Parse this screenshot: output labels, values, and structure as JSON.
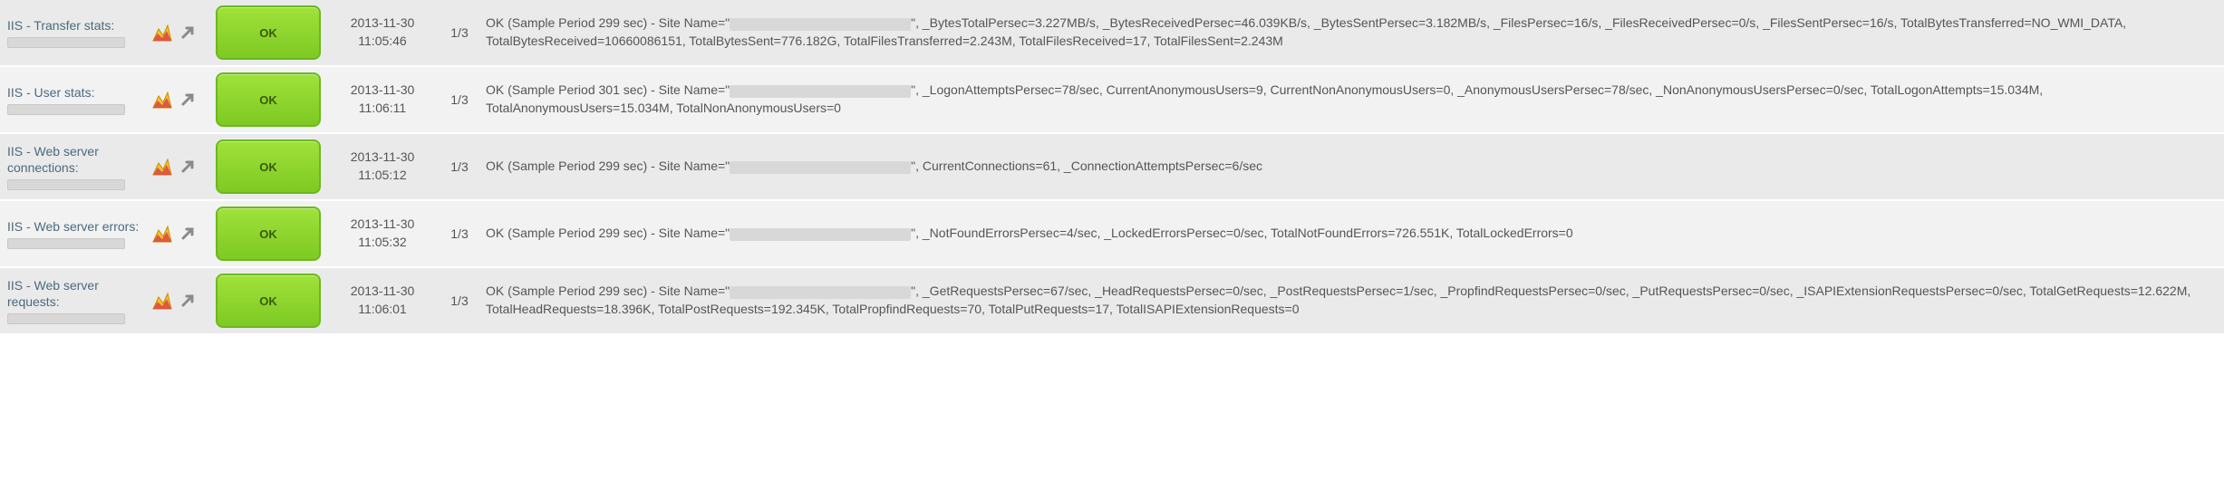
{
  "status_label": "OK",
  "colors": {
    "status_ok_bg": "#8ed62f",
    "status_ok_border": "#6bb81f"
  },
  "rows": [
    {
      "name": "IIS - Transfer stats:",
      "status": "OK",
      "timestamp": "2013-11-30 11:05:46",
      "count": "1/3",
      "sample_period": 299,
      "detail_pre": "OK (Sample Period 299 sec) - Site Name=\"",
      "detail_post": "\", _BytesTotalPersec=3.227MB/s, _BytesReceivedPersec=46.039KB/s, _BytesSentPersec=3.182MB/s, _FilesPersec=16/s, _FilesReceivedPersec=0/s, _FilesSentPersec=16/s, TotalBytesTransferred=NO_WMI_DATA, TotalBytesReceived=10660086151, TotalBytesSent=776.182G, TotalFilesTransferred=2.243M, TotalFilesReceived=17, TotalFilesSent=2.243M"
    },
    {
      "name": "IIS - User stats:",
      "status": "OK",
      "timestamp": "2013-11-30 11:06:11",
      "count": "1/3",
      "sample_period": 301,
      "detail_pre": "OK (Sample Period 301 sec) - Site Name=\"",
      "detail_post": "\", _LogonAttemptsPersec=78/sec, CurrentAnonymousUsers=9, CurrentNonAnonymousUsers=0, _AnonymousUsersPersec=78/sec, _NonAnonymousUsersPersec=0/sec, TotalLogonAttempts=15.034M, TotalAnonymousUsers=15.034M, TotalNonAnonymousUsers=0"
    },
    {
      "name": "IIS - Web server connections:",
      "status": "OK",
      "timestamp": "2013-11-30 11:05:12",
      "count": "1/3",
      "sample_period": 299,
      "detail_pre": "OK (Sample Period 299 sec) - Site Name=\"",
      "detail_post": "\", CurrentConnections=61, _ConnectionAttemptsPersec=6/sec"
    },
    {
      "name": "IIS - Web server errors:",
      "status": "OK",
      "timestamp": "2013-11-30 11:05:32",
      "count": "1/3",
      "sample_period": 299,
      "detail_pre": "OK (Sample Period 299 sec) - Site Name=\"",
      "detail_post": "\", _NotFoundErrorsPersec=4/sec, _LockedErrorsPersec=0/sec, TotalNotFoundErrors=726.551K, TotalLockedErrors=0"
    },
    {
      "name": "IIS - Web server requests:",
      "status": "OK",
      "timestamp": "2013-11-30 11:06:01",
      "count": "1/3",
      "sample_period": 299,
      "detail_pre": "OK (Sample Period 299 sec) - Site Name=\"",
      "detail_post": "\", _GetRequestsPersec=67/sec, _HeadRequestsPersec=0/sec, _PostRequestsPersec=1/sec, _PropfindRequestsPersec=0/sec, _PutRequestsPersec=0/sec, _ISAPIExtensionRequestsPersec=0/sec, TotalGetRequests=12.622M, TotalHeadRequests=18.396K, TotalPostRequests=192.345K, TotalPropfindRequests=70, TotalPutRequests=17, TotalISAPIExtensionRequests=0"
    }
  ]
}
